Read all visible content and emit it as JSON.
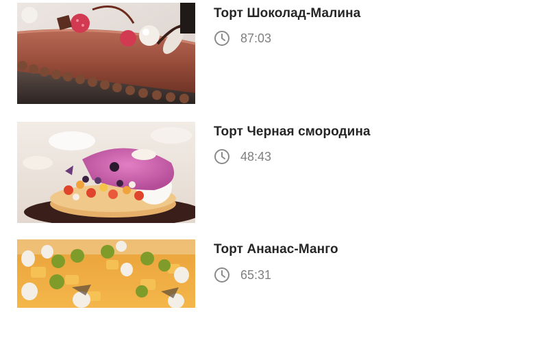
{
  "videos": [
    {
      "title": "Торт Шоколад-Малина",
      "duration": "87:03",
      "icon": "clock-icon",
      "thumbnail": "chocolate-raspberry-cake"
    },
    {
      "title": "Торт Черная смородина",
      "duration": "48:43",
      "icon": "clock-icon",
      "thumbnail": "blackcurrant-fruit-tart"
    },
    {
      "title": "Торт Ананас-Манго",
      "duration": "65:31",
      "icon": "clock-icon",
      "thumbnail": "pineapple-mango-cake"
    }
  ],
  "colors": {
    "title": "#262626",
    "duration": "#7f7f7f",
    "icon": "#8a8a8a",
    "background": "#ffffff"
  }
}
